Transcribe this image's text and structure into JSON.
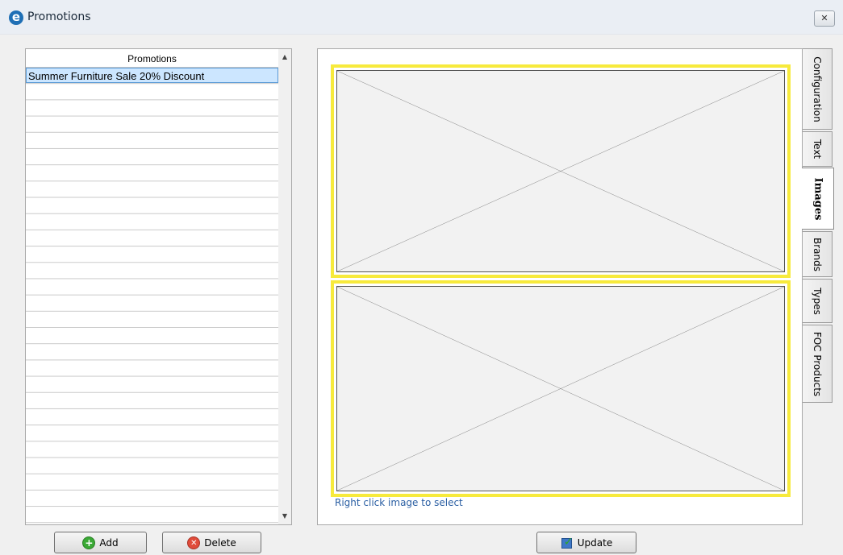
{
  "window": {
    "title": "Promotions",
    "logo_letter": "e",
    "close_glyph": "✕"
  },
  "promotions": {
    "header": "Promotions",
    "items": [
      {
        "label": "Summer Furniture Sale 20% Discount",
        "selected": true
      }
    ]
  },
  "buttons": {
    "add": "Add",
    "delete": "Delete",
    "update": "Update"
  },
  "images_panel": {
    "hint": "Right click image to select"
  },
  "tabs": [
    {
      "label": "Configuration",
      "active": false
    },
    {
      "label": "Text",
      "active": false
    },
    {
      "label": "Images",
      "active": true
    },
    {
      "label": "Brands",
      "active": false
    },
    {
      "label": "Types",
      "active": false
    },
    {
      "label": "FOC Products",
      "active": false
    }
  ],
  "colors": {
    "selection": "#cce6ff",
    "image_frame": "#f7ea3c",
    "hint_text": "#2b5fa3"
  }
}
